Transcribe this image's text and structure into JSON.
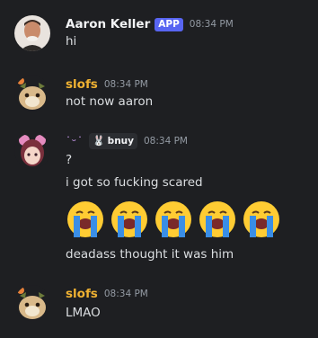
{
  "messages": [
    {
      "author": "Aaron Keller",
      "badge": "APP",
      "time": "08:34 PM",
      "lines": [
        "hi"
      ]
    },
    {
      "author": "slofs",
      "time": "08:34 PM",
      "lines": [
        "not now aaron"
      ]
    },
    {
      "author": "˙ᵕ˙",
      "tag": {
        "icon": "bunny-emoji",
        "label": "bnuy"
      },
      "time": "08:34 PM",
      "lines": [
        "?",
        "i got so fucking scared"
      ],
      "emoji_row": {
        "name": "loudly-crying-face",
        "count": 5
      },
      "after_emoji": "deadass thought it was him"
    },
    {
      "author": "slofs",
      "time": "08:34 PM",
      "lines": [
        "LMAO"
      ]
    }
  ]
}
